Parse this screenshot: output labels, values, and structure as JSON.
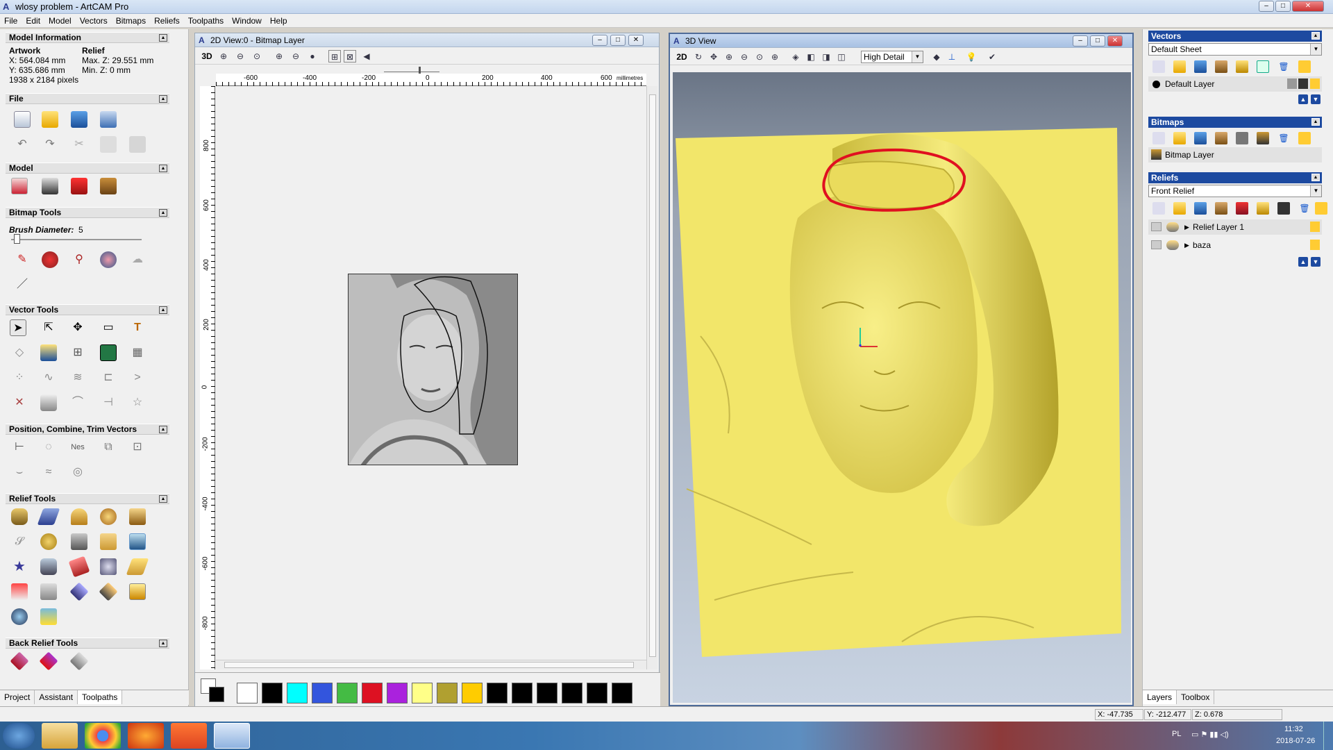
{
  "app": {
    "title": "wlosy problem - ArtCAM Pro",
    "logo": "A"
  },
  "window_controls": {
    "minimize": "–",
    "maximize": "□",
    "close": "✕"
  },
  "menu": [
    "File",
    "Edit",
    "Model",
    "Vectors",
    "Bitmaps",
    "Reliefs",
    "Toolpaths",
    "Window",
    "Help"
  ],
  "left_panel": {
    "model_info": {
      "title": "Model Information",
      "artwork_label": "Artwork",
      "relief_label": "Relief",
      "x": "X: 564.084 mm",
      "y": "Y: 635.686 mm",
      "pixels": "1938 x 2184 pixels",
      "max_z": "Max. Z: 29.551 mm",
      "min_z": "Min. Z: 0 mm"
    },
    "file_title": "File",
    "model_title": "Model",
    "bitmap_tools_title": "Bitmap Tools",
    "brush_label": "Brush Diameter:",
    "brush_value": "5",
    "vector_tools_title": "Vector Tools",
    "position_title": "Position, Combine, Trim Vectors",
    "relief_tools_title": "Relief Tools",
    "back_relief_title": "Back Relief Tools",
    "tabs": [
      "Project",
      "Assistant",
      "Toolpaths"
    ]
  },
  "view2d": {
    "title": "2D View:0 - Bitmap Layer",
    "mode_button": "3D",
    "ruler_h": [
      "-600",
      "-400",
      "-200",
      "0",
      "200",
      "400",
      "600"
    ],
    "ruler_unit": "millimetres",
    "ruler_v": [
      "800",
      "600",
      "400",
      "200",
      "0",
      "-200",
      "-400",
      "-600",
      "-800"
    ],
    "palette": [
      "#ffffff",
      "#000000",
      "#00ffff",
      "#3355dd",
      "#44bb44",
      "#dd1122",
      "#aa22dd",
      "#ffff88",
      "#b0a030",
      "#ffcc00",
      "#000000",
      "#000000",
      "#000000",
      "#000000",
      "#000000",
      "#000000"
    ]
  },
  "view3d": {
    "title": "3D View",
    "mode_button": "2D",
    "detail_select": "High Detail",
    "relief_color": "#f2e66a",
    "highlight_color": "#e01020"
  },
  "right_panel": {
    "vectors_title": "Vectors",
    "sheet_select": "Default Sheet",
    "default_layer": "Default Layer",
    "bitmaps_title": "Bitmaps",
    "bitmap_layer": "Bitmap Layer",
    "reliefs_title": "Reliefs",
    "relief_select": "Front Relief",
    "relief_layers": [
      "Relief Layer 1",
      "baza"
    ],
    "tabs": [
      "Layers",
      "Toolbox"
    ]
  },
  "status": {
    "x": "X: -47.735",
    "y": "Y: -212.477",
    "z": "Z: 0.678"
  },
  "taskbar": {
    "lang": "PL",
    "time": "11:32",
    "date": "2018-07-26"
  }
}
